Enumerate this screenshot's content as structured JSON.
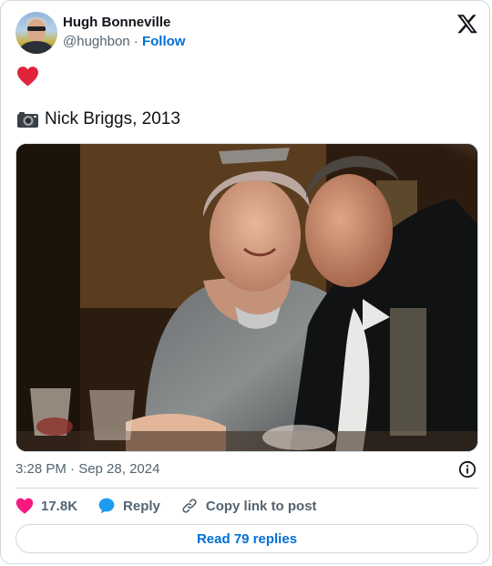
{
  "author": {
    "name": "Hugh Bonneville",
    "handle": "@hughbon",
    "separator": "·",
    "follow_label": "Follow"
  },
  "post": {
    "emoji_line": "❤️",
    "camera_emoji": "📷",
    "caption": "Nick Briggs, 2013",
    "timestamp": "3:28 PM · Sep 28, 2024"
  },
  "actions": {
    "likes": "17.8K",
    "reply_label": "Reply",
    "copy_link_label": "Copy link to post"
  },
  "read_replies_label": "Read 79 replies",
  "colors": {
    "accent": "#006fd6",
    "like_heart": "#f91880",
    "reply_bubble": "#1d9bf0",
    "muted_text": "#536471",
    "border": "#cfd9de"
  },
  "icons": [
    "x-logo-icon",
    "heart-icon",
    "camera-icon",
    "info-icon",
    "like-heart-icon",
    "reply-bubble-icon",
    "link-icon"
  ]
}
